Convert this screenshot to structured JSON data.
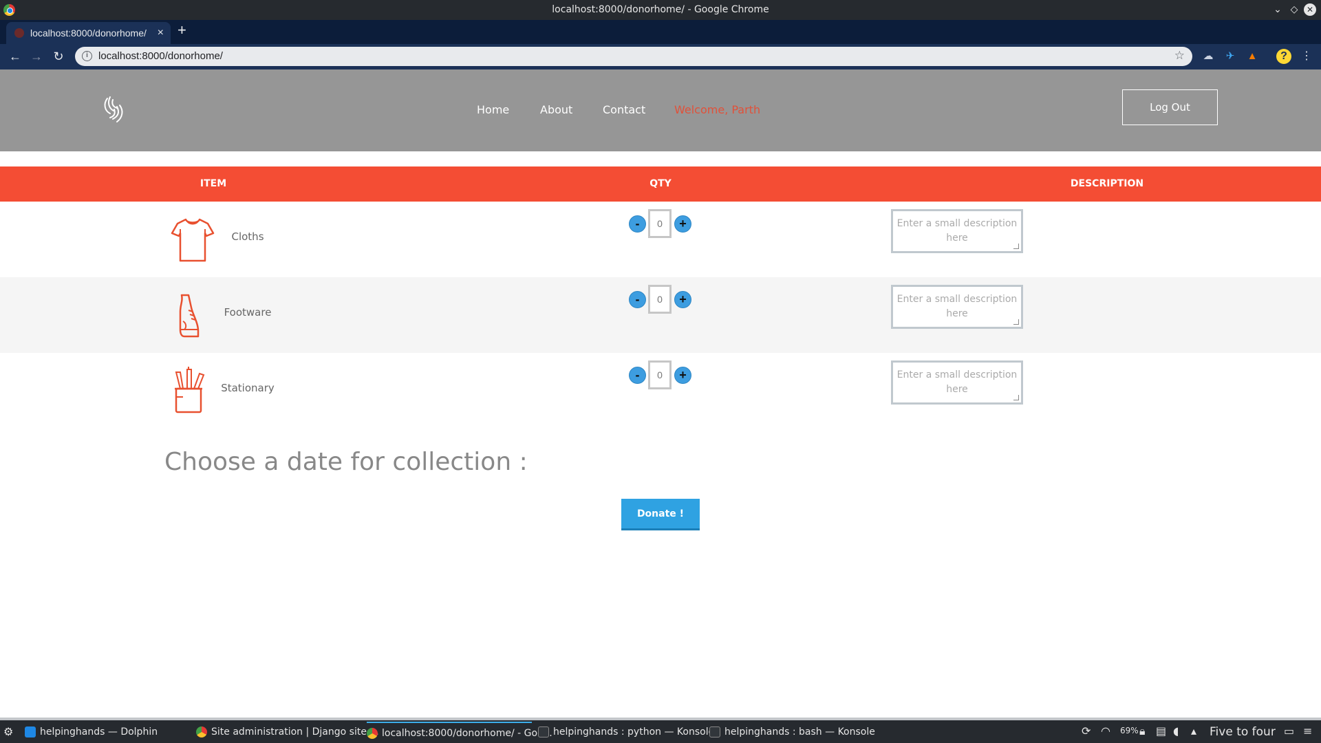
{
  "window": {
    "title": "localhost:8000/donorhome/ - Google Chrome",
    "min_glyph": "⌄",
    "max_glyph": "◇",
    "close_glyph": "✕"
  },
  "browser": {
    "tab_title": "localhost:8000/donorhome/",
    "tab_close": "×",
    "new_tab": "+",
    "back": "←",
    "forward": "→",
    "reload": "↻",
    "info": "i",
    "url": "localhost:8000/donorhome/",
    "star": "☆",
    "menu": "⋮",
    "help": "?"
  },
  "site": {
    "nav": {
      "home": "Home",
      "about": "About",
      "contact": "Contact",
      "welcome": "Welcome, Parth"
    },
    "logout": "Log Out",
    "table": {
      "headers": {
        "item": "ITEM",
        "qty": "QTY",
        "description": "DESCRIPTION"
      },
      "rows": [
        {
          "name": "Cloths",
          "icon": "tshirt-icon",
          "qty": "0",
          "description_placeholder": "Enter a small description here"
        },
        {
          "name": "Footware",
          "icon": "shoe-icon",
          "qty": "0",
          "description_placeholder": "Enter a small description here"
        },
        {
          "name": "Stationary",
          "icon": "pencil-cup-icon",
          "qty": "0",
          "description_placeholder": "Enter a small description here"
        }
      ],
      "minus": "-",
      "plus": "+"
    },
    "collection_label": "Choose a date for collection :",
    "donate_button": "Donate !"
  },
  "taskbar": {
    "tasks": [
      {
        "label": "helpinghands — Dolphin",
        "icon": "dolphin-icon"
      },
      {
        "label": "Site administration | Django site ...",
        "icon": "chrome-icon"
      },
      {
        "label": "localhost:8000/donorhome/ - Goo...",
        "icon": "chrome-icon",
        "active": true
      },
      {
        "label": "helpinghands : python — Konsole",
        "icon": "konsole-icon"
      },
      {
        "label": "helpinghands : bash — Konsole",
        "icon": "konsole-icon"
      }
    ],
    "clock": "Five to four",
    "battery": "69%"
  },
  "colors": {
    "header_bg": "#969696",
    "accent_red": "#f44d34",
    "welcome_text": "#e0513a",
    "button_blue": "#2fa2e2",
    "icon_orange": "#e8502f"
  }
}
